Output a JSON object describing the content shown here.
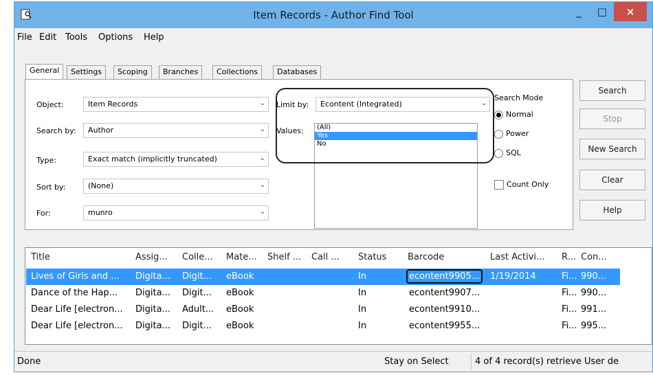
{
  "window": {
    "title": "Item Records - Author Find Tool"
  },
  "titlebar_buttons": {
    "minimize": "_",
    "maximize": "□",
    "close": "×"
  },
  "menu": [
    "File",
    "Edit",
    "Tools",
    "Options",
    "Help"
  ],
  "tabs": [
    "General",
    "Settings",
    "Scoping",
    "Branches",
    "Collections",
    "Databases"
  ],
  "form": {
    "object_label": "Object:",
    "object_value": "Item Records",
    "search_by_label": "Search by:",
    "search_by_value": "Author",
    "type_label": "Type:",
    "type_value": "Exact match (implicitly truncated)",
    "sort_by_label": "Sort by:",
    "sort_by_value": "(None)",
    "for_label": "For:",
    "for_value": "munro"
  },
  "limit": {
    "label": "Limit by:",
    "value": "Econtent (Integrated)",
    "values_label": "Values:",
    "options": [
      "(All)",
      "Yes",
      "No"
    ],
    "selected_option": "Yes"
  },
  "search_mode": {
    "label": "Search Mode",
    "options": [
      "Normal",
      "Power",
      "SQL"
    ],
    "selected": "Normal",
    "count_only": "Count Only"
  },
  "buttons": {
    "search": "Search",
    "stop": "Stop",
    "new_search": "New Search",
    "clear": "Clear",
    "help": "Help"
  },
  "results": {
    "columns": [
      "Title",
      "Assig...",
      "Colle...",
      "Mate...",
      "Shelf ...",
      "Call ...",
      "Status",
      "Barcode",
      "Last Activi...",
      "R...",
      "Con..."
    ],
    "rows": [
      [
        "Lives of Girls and ...",
        "Digita...",
        "Digit...",
        "eBook",
        "",
        "",
        "In",
        "econtent9905...",
        "1/19/2014",
        "Fi...",
        "990..."
      ],
      [
        "Dance of the Hap...",
        "Digita...",
        "Digit...",
        "eBook",
        "",
        "",
        "In",
        "econtent9907...",
        "",
        "Fi...",
        "990..."
      ],
      [
        "Dear Life [electron...",
        "Digita...",
        "Adult...",
        "eBook",
        "",
        "",
        "In",
        "econtent9910...",
        "",
        "Fi...",
        "991..."
      ],
      [
        "Dear Life [electron...",
        "Digita...",
        "Digit...",
        "eBook",
        "",
        "",
        "In",
        "econtent9955...",
        "",
        "Fi...",
        "995..."
      ]
    ]
  },
  "status": {
    "left": "Done",
    "middle": "Stay on Select",
    "right": "4 of 4 record(s) retrieve User de"
  },
  "colors": {
    "titlebar": "#6fb3ea",
    "selection": "#3399ff",
    "close": "#c7504b"
  }
}
